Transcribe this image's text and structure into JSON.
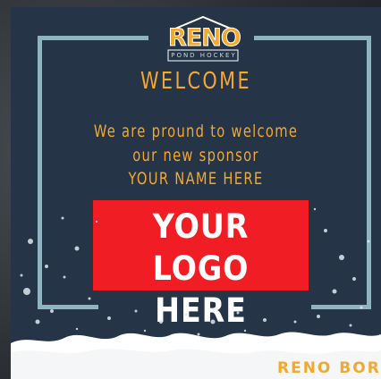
{
  "logo": {
    "name": "RENO",
    "subtitle": "POND HOCKEY"
  },
  "heading": "WELCOME",
  "message": {
    "line1": "We are pround to welcome",
    "line2": "our new sponsor",
    "line3": "YOUR NAME HERE"
  },
  "logo_placeholder": {
    "line1": "YOUR LOGO",
    "line2": "HERE"
  },
  "tagline": "RENO BORN",
  "colors": {
    "card_background": "#253447",
    "frame": "#8fb3c1",
    "accent_text": "#f3a92f",
    "logo_box": "#f01e24",
    "snow": "#ffffff"
  }
}
